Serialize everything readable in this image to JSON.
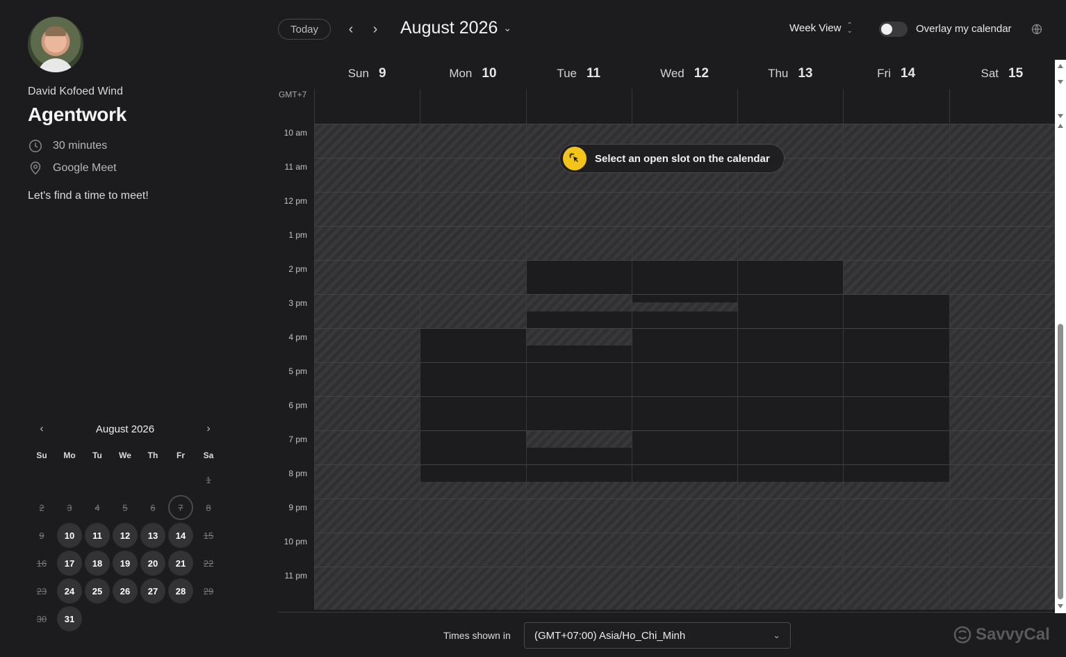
{
  "host": {
    "name": "David Kofoed Wind",
    "avatar_icon": "avatar"
  },
  "event": {
    "title": "Agentwork",
    "duration": "30 minutes",
    "location": "Google Meet",
    "description": "Let's find a time to meet!"
  },
  "mini_calendar": {
    "month_label": "August 2026",
    "weekday_labels": [
      "Su",
      "Mo",
      "Tu",
      "We",
      "Th",
      "Fr",
      "Sa"
    ],
    "weeks": [
      [
        null,
        null,
        null,
        null,
        null,
        null,
        {
          "d": "1",
          "s": "off"
        }
      ],
      [
        {
          "d": "2",
          "s": "off"
        },
        {
          "d": "3",
          "s": "off"
        },
        {
          "d": "4",
          "s": "off"
        },
        {
          "d": "5",
          "s": "off"
        },
        {
          "d": "6",
          "s": "off"
        },
        {
          "d": "7",
          "s": "today"
        },
        {
          "d": "8",
          "s": "off"
        }
      ],
      [
        {
          "d": "9",
          "s": "off"
        },
        {
          "d": "10",
          "s": "on"
        },
        {
          "d": "11",
          "s": "on"
        },
        {
          "d": "12",
          "s": "on"
        },
        {
          "d": "13",
          "s": "on"
        },
        {
          "d": "14",
          "s": "on"
        },
        {
          "d": "15",
          "s": "off"
        }
      ],
      [
        {
          "d": "16",
          "s": "off"
        },
        {
          "d": "17",
          "s": "on"
        },
        {
          "d": "18",
          "s": "on"
        },
        {
          "d": "19",
          "s": "on"
        },
        {
          "d": "20",
          "s": "on"
        },
        {
          "d": "21",
          "s": "on"
        },
        {
          "d": "22",
          "s": "off"
        }
      ],
      [
        {
          "d": "23",
          "s": "off"
        },
        {
          "d": "24",
          "s": "on"
        },
        {
          "d": "25",
          "s": "on"
        },
        {
          "d": "26",
          "s": "on"
        },
        {
          "d": "27",
          "s": "on"
        },
        {
          "d": "28",
          "s": "on"
        },
        {
          "d": "29",
          "s": "off"
        }
      ],
      [
        {
          "d": "30",
          "s": "off"
        },
        {
          "d": "31",
          "s": "on"
        },
        null,
        null,
        null,
        null,
        null
      ]
    ]
  },
  "toolbar": {
    "today_label": "Today",
    "month_label": "August 2026",
    "view_label": "Week View",
    "overlay_label": "Overlay my calendar",
    "overlay_enabled": false
  },
  "week": {
    "days": [
      {
        "dow": "Sun",
        "num": "9"
      },
      {
        "dow": "Mon",
        "num": "10"
      },
      {
        "dow": "Tue",
        "num": "11"
      },
      {
        "dow": "Wed",
        "num": "12"
      },
      {
        "dow": "Thu",
        "num": "13"
      },
      {
        "dow": "Fri",
        "num": "14"
      },
      {
        "dow": "Sat",
        "num": "15"
      }
    ],
    "timezone_short": "GMT+7",
    "hour_labels": [
      "10 am",
      "11 am",
      "12 pm",
      "1 pm",
      "2 pm",
      "3 pm",
      "4 pm",
      "5 pm",
      "6 pm",
      "7 pm",
      "8 pm",
      "9 pm",
      "10 pm",
      "11 pm"
    ],
    "open_slots": [
      {
        "day": 1,
        "start": "16:00",
        "end": "20:30"
      },
      {
        "day": 2,
        "start": "14:00",
        "end": "15:00"
      },
      {
        "day": 2,
        "start": "15:30",
        "end": "16:00"
      },
      {
        "day": 2,
        "start": "16:30",
        "end": "19:00"
      },
      {
        "day": 2,
        "start": "19:30",
        "end": "20:30"
      },
      {
        "day": 2,
        "start": "21:00",
        "end": "20:30"
      },
      {
        "day": 3,
        "start": "14:00",
        "end": "15:15"
      },
      {
        "day": 3,
        "start": "15:30",
        "end": "20:30"
      },
      {
        "day": 4,
        "start": "14:00",
        "end": "20:30"
      },
      {
        "day": 5,
        "start": "15:00",
        "end": "20:30"
      }
    ],
    "hint": "Select an open slot on the calendar"
  },
  "footer": {
    "times_label": "Times shown in",
    "timezone_value": "(GMT+07:00) Asia/Ho_Chi_Minh",
    "brand": "SavvyCal"
  },
  "colors": {
    "accent": "#f3c51a",
    "background": "#1c1c1e"
  }
}
